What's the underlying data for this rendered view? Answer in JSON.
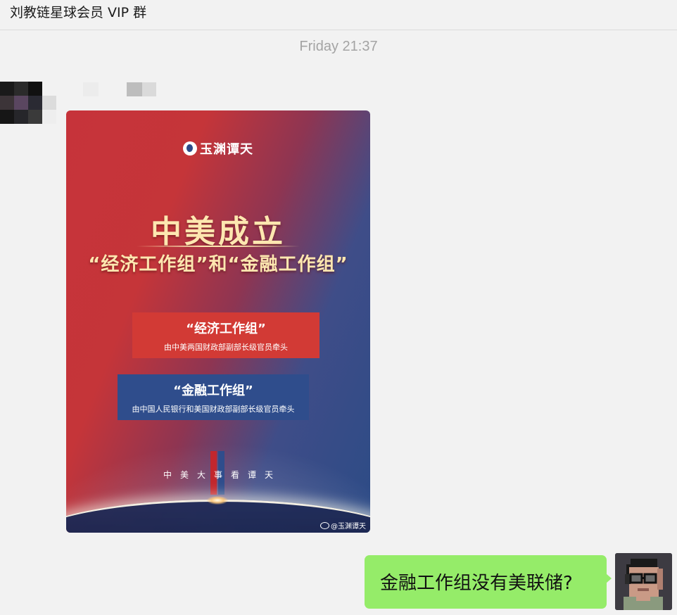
{
  "chat": {
    "title": "刘教链星球会员 VIP 群",
    "timestamp": "Friday 21:37"
  },
  "image_message": {
    "logo_text": "玉渊谭天",
    "headline": "中美成立",
    "subheadline": "“经济工作组”和“金融工作组”",
    "cards": [
      {
        "title": "“经济工作组”",
        "description": "由中美两国财政部副部长级官员牵头",
        "color": "#d23a35"
      },
      {
        "title": "“金融工作组”",
        "description": "由中国人民银行和美国财政部副部长级官员牵头",
        "color": "#2f4d8c"
      }
    ],
    "slogan": "中美大事看谭天",
    "watermark": "@玉渊谭天",
    "watermark_icon": "weibo-icon"
  },
  "outgoing_message": {
    "text": "金融工作组没有美联储?"
  },
  "colors": {
    "background": "#f2f2f2",
    "bubble": "#95ec69",
    "timestamp": "#a4a4a4",
    "poster_red": "#c6333a",
    "poster_blue": "#2c4b86",
    "poster_gold": "#fde7b0"
  }
}
